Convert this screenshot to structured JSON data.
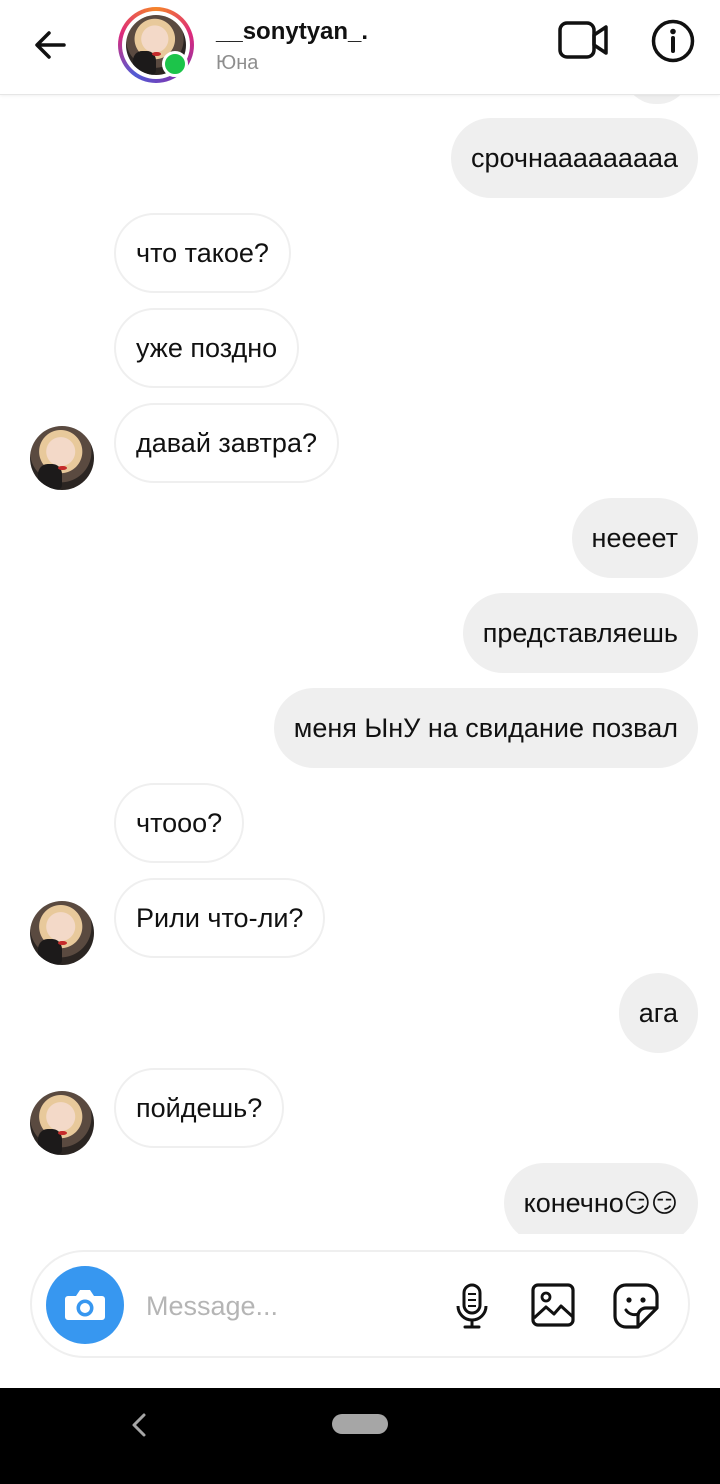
{
  "header": {
    "username": "__sonytyan_.",
    "subtitle": "Юна",
    "online": true
  },
  "messages": [
    {
      "dir": "out",
      "text": "срочнааааааааа"
    },
    {
      "dir": "in",
      "text": "что такое?"
    },
    {
      "dir": "in",
      "text": "уже поздно"
    },
    {
      "dir": "in",
      "text": "давай завтра?",
      "avatar": true
    },
    {
      "dir": "out",
      "text": "неееет"
    },
    {
      "dir": "out",
      "text": "представляешь"
    },
    {
      "dir": "out",
      "text": "меня ЫнУ на свидание позвал"
    },
    {
      "dir": "in",
      "text": "чтооо?"
    },
    {
      "dir": "in",
      "text": "Рили что-ли?",
      "avatar": true
    },
    {
      "dir": "out",
      "text": "ага"
    },
    {
      "dir": "in",
      "text": "пойдешь?",
      "avatar": true
    },
    {
      "dir": "out",
      "text": "конечно",
      "emoji": "😏😏"
    }
  ],
  "composer": {
    "placeholder": "Message..."
  },
  "icons": {
    "back": "back-arrow-icon",
    "video": "video-call-icon",
    "info": "info-icon",
    "camera": "camera-icon",
    "mic": "microphone-icon",
    "gallery": "image-gallery-icon",
    "sticker": "sticker-icon"
  },
  "colors": {
    "accent": "#3797f0",
    "online": "#1cc44a",
    "outgoing_bubble": "#efefef"
  }
}
